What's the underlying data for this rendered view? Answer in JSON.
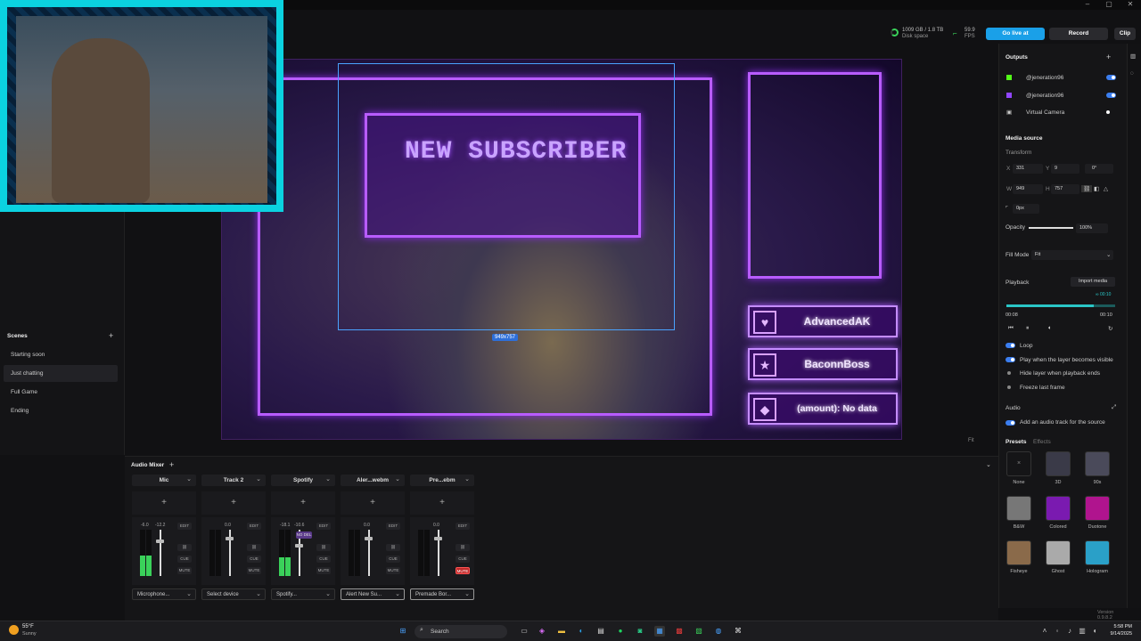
{
  "topbar": {
    "disk": "1009 GB / 1.8 TB",
    "disk_label": "Disk space",
    "fps": "59.9",
    "fps_label": "FPS",
    "golive": "Go live at",
    "record": "Record",
    "clip": "Clip"
  },
  "scenes": {
    "header": "Scenes",
    "add": "+",
    "items": [
      "Starting soon",
      "Just chatting",
      "Full Game",
      "Ending"
    ]
  },
  "canvas": {
    "alert_title": "NEW SUBSCRIBER",
    "selection_size": "949x757",
    "recent": [
      "AdvancedAK",
      "BaconnBoss",
      "(amount): No data"
    ],
    "fit": "Fit"
  },
  "mixer": {
    "title": "Audio Mixer",
    "add": "+",
    "tracks": [
      {
        "name": "Mic",
        "device": "Microphone...",
        "db1": "-6.0",
        "db2": "-12.2",
        "level": 0.45,
        "fader": 0.78,
        "active": true
      },
      {
        "name": "Track 2",
        "device": "Select device",
        "db1": "",
        "db2": "0.0",
        "level": 0.0,
        "fader": 0.85,
        "active": false
      },
      {
        "name": "Spotify",
        "device": "Spotify...",
        "db1": "-18.1",
        "db2": "-10.6",
        "level": 0.4,
        "fader": 0.7,
        "active": true
      },
      {
        "name": "Aler...webm",
        "device": "Alert New Su...",
        "db1": "",
        "db2": "0.0",
        "level": 0.0,
        "fader": 0.85,
        "active": false
      },
      {
        "name": "Pre...ebm",
        "device": "Premade Bor...",
        "db1": "",
        "db2": "0.0",
        "level": 0.0,
        "fader": 0.85,
        "active": false
      }
    ],
    "btn_edit": "EDIT",
    "btn_cue": "CUE",
    "btn_mute": "MUTE",
    "btn_nodel": "NO DEL"
  },
  "outputs": {
    "header": "Outputs",
    "add": "+",
    "items": [
      "@jeneration96",
      "@jeneration96",
      "Virtual Camera"
    ]
  },
  "media": {
    "header": "Media source",
    "transform": "Transform",
    "x_label": "X",
    "x": "331",
    "y_label": "Y",
    "y": "9",
    "rot": "0°",
    "w_label": "W",
    "w": "949",
    "h_label": "H",
    "h": "757",
    "radius": "0px",
    "opacity_label": "Opacity",
    "opacity": "100%",
    "opacity_value": 1.0,
    "fill_mode_label": "Fill Mode",
    "fill_mode": "Fit",
    "playback": "Playback",
    "import": "Import media",
    "marker": "∞ 00:10",
    "start": "00:08",
    "end": "00:10",
    "progress": 0.8,
    "loop": "Loop",
    "play_visible": "Play when the layer becomes visible",
    "hide_end": "Hide layer when playback ends",
    "freeze": "Freeze last frame",
    "audio": "Audio",
    "audio_track": "Add an audio track for the source",
    "presets": "Presets",
    "effects": "Effects",
    "preset_items": [
      "None",
      "3D",
      "90s",
      "B&W",
      "Colored",
      "Duotone",
      "Fisheye",
      "Ghost",
      "Hologram"
    ],
    "version": "Version 0.9.8.2"
  },
  "taskbar": {
    "temp": "55°F",
    "weather": "Sunny",
    "search": "Search",
    "time": "5:58 PM",
    "date": "9/14/2025"
  }
}
